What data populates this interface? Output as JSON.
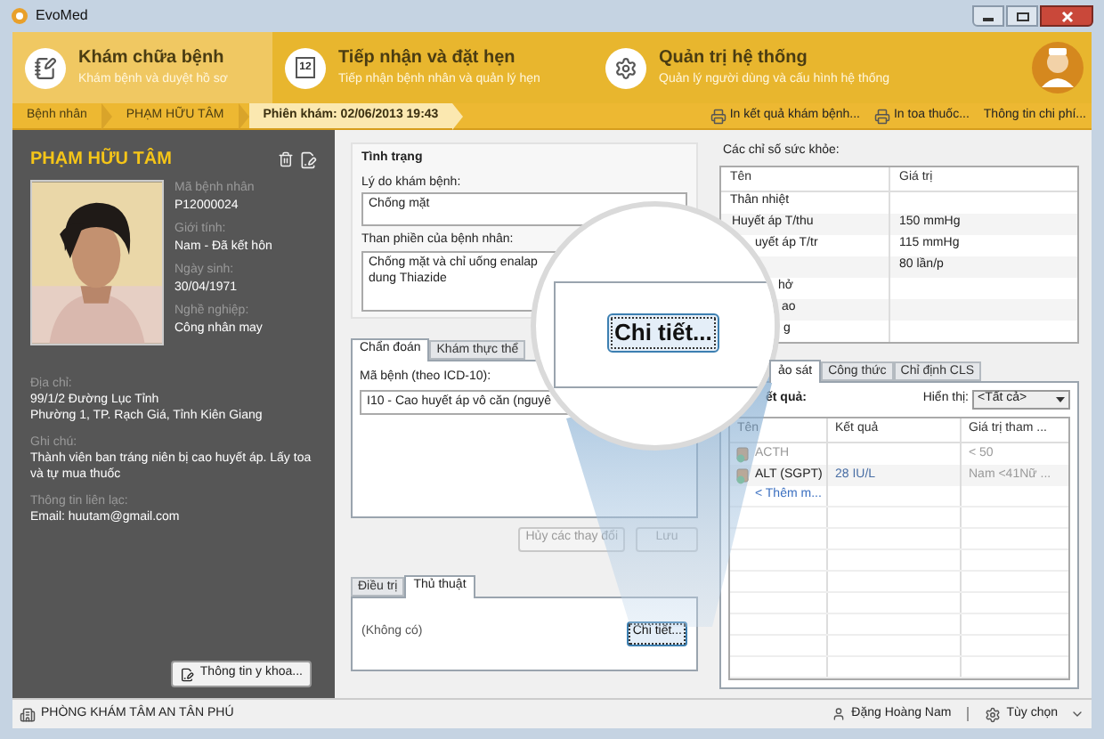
{
  "window": {
    "title": "EvoMed"
  },
  "modules": [
    {
      "title": "Khám chữa bệnh",
      "subtitle": "Khám bệnh và duyệt hồ sơ",
      "selected": true
    },
    {
      "title": "Tiếp nhận và đặt hẹn",
      "subtitle": "Tiếp nhận bệnh nhân và quản lý hẹn",
      "selected": false,
      "icon_text": "12"
    },
    {
      "title": "Quản trị hệ thống",
      "subtitle": "Quản lý người dùng và cấu hình hệ thống",
      "selected": false
    }
  ],
  "breadcrumb": [
    {
      "label": "Bệnh nhân",
      "selected": false
    },
    {
      "label": "PHẠM HỮU TÂM",
      "selected": false
    },
    {
      "label": "Phiên khám: 02/06/2013 19:43",
      "selected": true
    }
  ],
  "actions": [
    {
      "label": "In kết quả khám bệnh...",
      "kind": "print"
    },
    {
      "label": "In toa thuốc...",
      "kind": "print"
    },
    {
      "label": "Thông tin chi phí...",
      "kind": "link"
    }
  ],
  "patient": {
    "name": "PHẠM HỮU TÂM",
    "fields": [
      {
        "label": "Mã bệnh nhân",
        "value": "P12000024"
      },
      {
        "label": "Giới tính:",
        "value": "Nam - Đã kết hôn"
      },
      {
        "label": "Ngày sinh:",
        "value": "30/04/1971"
      },
      {
        "label": "Nghề nghiệp:",
        "value": "Công nhân may"
      }
    ],
    "details": [
      {
        "label": "Địa chỉ:",
        "value": "99/1/2 Đường Lục Tỉnh\nPhường 1, TP. Rạch Giá, Tỉnh Kiên Giang"
      },
      {
        "label": "Ghi chú:",
        "value": "Thành viên ban tráng niên bị cao huyết áp. Lấy toa và tự mua thuốc"
      },
      {
        "label": "Thông tin liên lạc:",
        "value": "Email: huutam@gmail.com"
      }
    ],
    "medical_button": "Thông tin y khoa..."
  },
  "condition": {
    "title": "Tình trạng",
    "reason_label": "Lý do khám bệnh:",
    "reason_value": "Chống mặt",
    "complaint_label": "Than phiền của bệnh nhân:",
    "complaint_lines": [
      "Chống mặt và chỉ uống enalap",
      "dung Thiazide"
    ]
  },
  "diagnosis": {
    "tabs": [
      {
        "label": "Chẩn đoán",
        "selected": true
      },
      {
        "label": "Khám thực thể",
        "selected": false
      }
    ],
    "icd_label": "Mã bệnh (theo ICD-10):",
    "icd_value": "I10 - Cao huyết áp vô căn (nguyê"
  },
  "form_buttons": [
    {
      "label": "Hủy các thay đổi",
      "disabled": true
    },
    {
      "label": "Lưu",
      "disabled": true
    }
  ],
  "treatment": {
    "tabs": [
      {
        "label": "Điều trị",
        "selected": false
      },
      {
        "label": "Thủ thuật",
        "selected": true
      }
    ],
    "value": "(Không có)",
    "detail_button": "Chi tiết..."
  },
  "magnifier": {
    "button": "Chi tiết..."
  },
  "vitals": {
    "title": "Các chỉ số sức khỏe:",
    "columns": [
      "Tên",
      "Giá trị"
    ],
    "rows": [
      {
        "name": "Thân nhiệt"
      },
      {
        "name": "Huyết áp T/thu",
        "value": "150 mmHg"
      },
      {
        "name": "uyết áp T/tr",
        "value": "115 mmHg"
      },
      {
        "value": "80 lần/p"
      },
      {
        "name": "hở"
      },
      {
        "name": "ao"
      },
      {
        "name": "g"
      }
    ]
  },
  "labs": {
    "tabs": [
      {
        "label": "ảo sát",
        "selected": true
      },
      {
        "label": "Công thức",
        "selected": false
      },
      {
        "label": "Chỉ định CLS",
        "selected": false
      }
    ],
    "results_label": "ết quả:",
    "filter_label": "Hiển thị:",
    "filter_value": "<Tất cả>",
    "columns": [
      "Tên",
      "Kết quả",
      "Giá trị tham ..."
    ],
    "rows": [
      {
        "name": "ACTH",
        "reference": "< 50",
        "dimmed": true
      },
      {
        "name": "ALT (SGPT)",
        "result": "28 IU/L",
        "reference": "Nam <41Nữ ...",
        "dimmed": false
      }
    ],
    "add_link": "< Thêm m..."
  },
  "status_bar": {
    "clinic": "PHÒNG KHÁM TÂM AN TÂN PHÚ",
    "user": "Đặng Hoàng Nam",
    "options": "Tùy chọn"
  }
}
